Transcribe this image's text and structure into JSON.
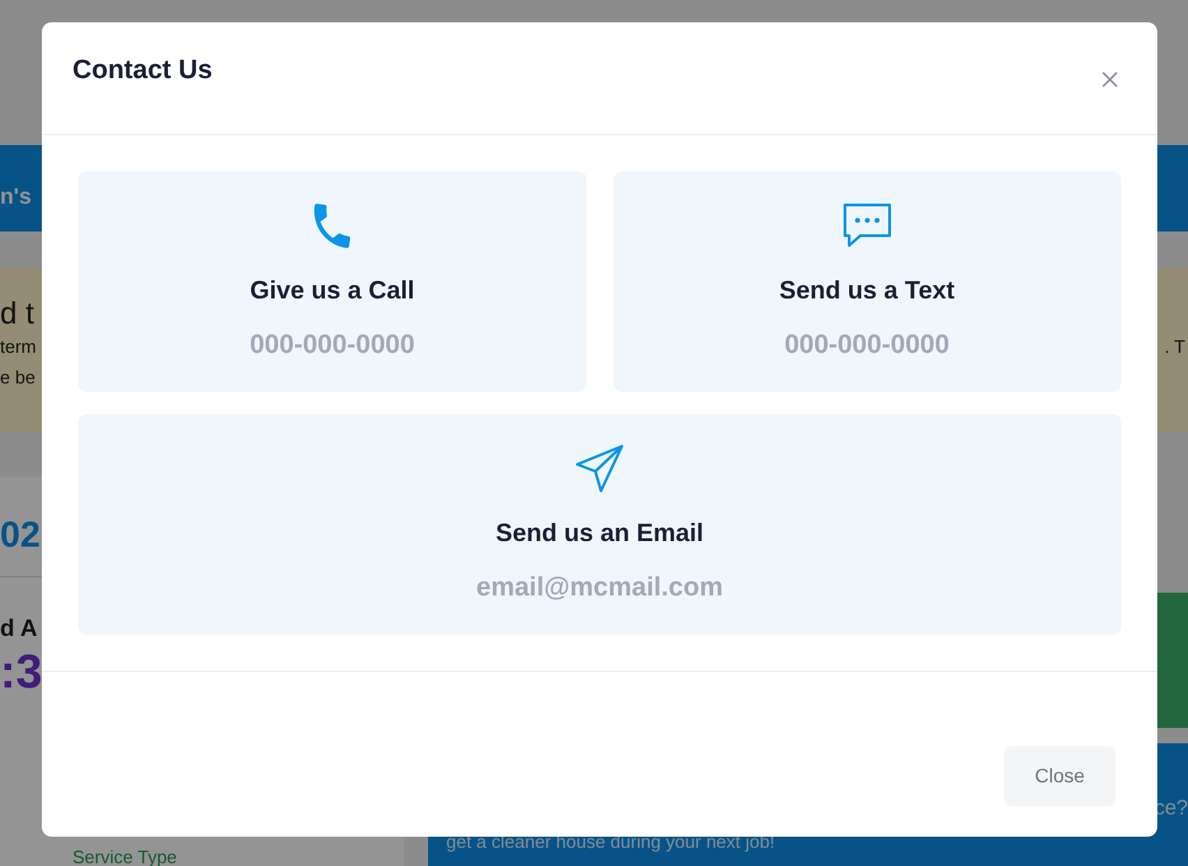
{
  "background": {
    "banner_text": "n's",
    "notice": {
      "heading": "d t",
      "lines": [
        "term",
        "e be"
      ],
      "right_text": ". T"
    },
    "left_panel": {
      "date": "02",
      "label": "d A",
      "time": ":3",
      "field_label": "Service Type"
    },
    "promo": {
      "question": "ce?",
      "line": "get a cleaner house during your next job!"
    }
  },
  "modal": {
    "title": "Contact Us",
    "options": [
      {
        "kind": "phone",
        "title": "Give us a Call",
        "detail": "000-000-0000"
      },
      {
        "kind": "text",
        "title": "Send us a Text",
        "detail": "000-000-0000"
      },
      {
        "kind": "email",
        "title": "Send us an Email",
        "detail": "email@mcmail.com"
      }
    ],
    "footer_button": "Close"
  }
}
